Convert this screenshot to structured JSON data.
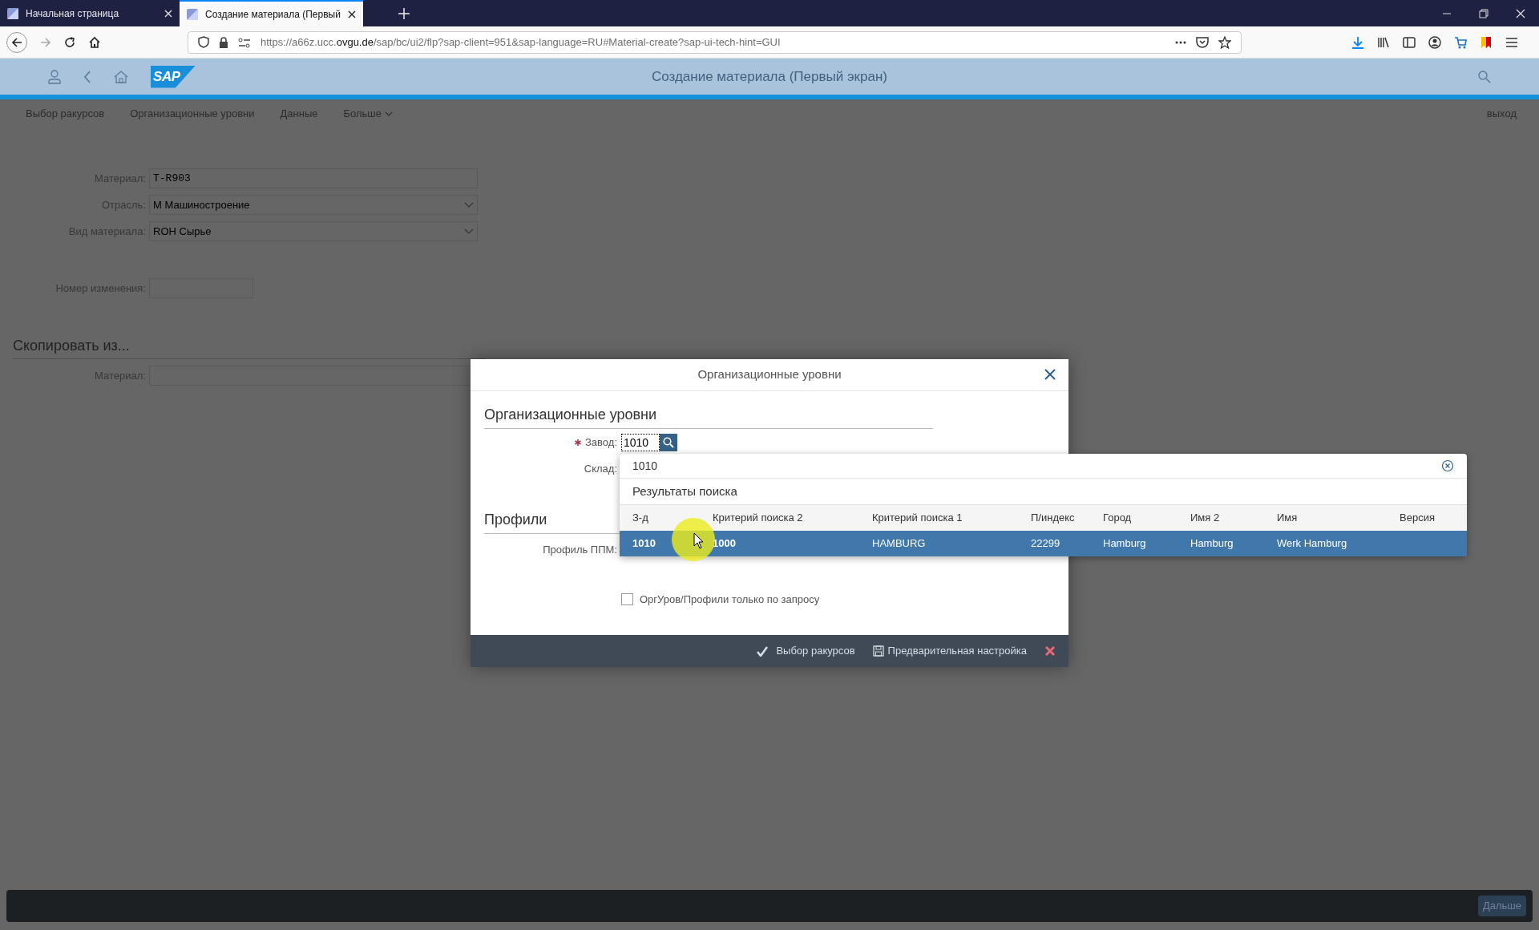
{
  "browser": {
    "tabs": [
      {
        "title": "Начальная страница",
        "selected": false
      },
      {
        "title": "Создание материала (Первый",
        "selected": true
      }
    ],
    "url": "https://a66z.ucc.**ovgu.de**/sap/bc/ui2/flp?sap-client=951&sap-language=RU#Material-create?sap-ui-tech-hint=GUI"
  },
  "shell": {
    "logo": "SAP",
    "title": "Создание материала (Первый экран)"
  },
  "toolbar": {
    "items": [
      {
        "label": "Выбор ракурсов",
        "kind": "plain"
      },
      {
        "label": "Организационные уровни",
        "kind": "plain"
      },
      {
        "label": "Данные",
        "kind": "plain"
      },
      {
        "label": "Больше",
        "kind": "menu"
      }
    ],
    "exit": "выход"
  },
  "form": {
    "fields": [
      {
        "label": "Материал:",
        "value": "T-R903",
        "kind": "text"
      },
      {
        "label": "Отрасль:",
        "value": "M Машиностроение",
        "kind": "select"
      },
      {
        "label": "Вид материала:",
        "value": "ROH Сырье",
        "kind": "select"
      }
    ],
    "change_number": {
      "label": "Номер изменения:"
    },
    "copy_section": {
      "title": "Скопировать из...",
      "field": {
        "label": "Материал:"
      }
    }
  },
  "dialog": {
    "title": "Организационные уровни",
    "section_title": "Организационные уровни",
    "plant": {
      "label": "Завод:",
      "value": "1010",
      "required": true
    },
    "storage": {
      "label": "Склад:"
    },
    "profiles_title": "Профили",
    "profile_label": "Профиль ППМ:",
    "checkbox": {
      "label": "ОргУров/Профили только по запросу",
      "checked": false
    },
    "footer": [
      {
        "label": "Выбор ракурсов",
        "kind": "confirm"
      },
      {
        "label": "Предварительная настройка",
        "kind": "save"
      },
      {
        "kind": "cancel"
      }
    ]
  },
  "dropdown": {
    "query": "1010",
    "results_title": "Результаты поиска",
    "columns": [
      "З-д",
      "Критерий поиска 2",
      "Критерий поиска 1",
      "П/индекс",
      "Город",
      "Имя 2",
      "Имя",
      "Версия"
    ],
    "rows": [
      {
        "cells": [
          "1010",
          "1000",
          "HAMBURG",
          "22299",
          "Hamburg",
          "Hamburg",
          "Werk Hamburg"
        ],
        "selected": true
      }
    ]
  },
  "bottom_bar": {
    "next": "Дальше"
  }
}
